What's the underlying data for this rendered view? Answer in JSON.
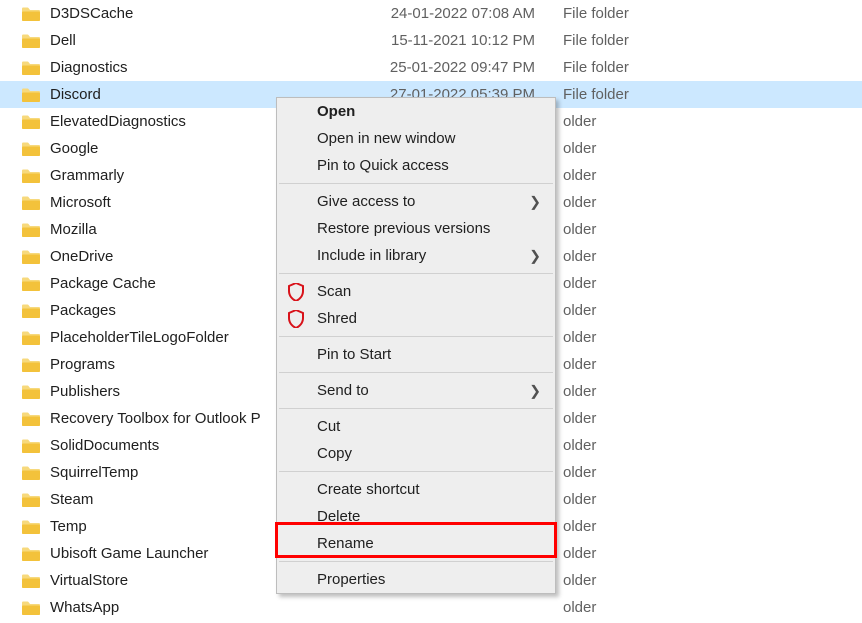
{
  "type_label": "File folder",
  "rows": [
    {
      "name": "D3DSCache",
      "date": "24-01-2022 07:08 AM"
    },
    {
      "name": "Dell",
      "date": "15-11-2021 10:12 PM"
    },
    {
      "name": "Diagnostics",
      "date": "25-01-2022 09:47 PM"
    },
    {
      "name": "Discord",
      "date": "27-01-2022 05:39 PM",
      "selected": true
    },
    {
      "name": "ElevatedDiagnostics"
    },
    {
      "name": "Google"
    },
    {
      "name": "Grammarly"
    },
    {
      "name": "Microsoft"
    },
    {
      "name": "Mozilla"
    },
    {
      "name": "OneDrive"
    },
    {
      "name": "Package Cache"
    },
    {
      "name": "Packages"
    },
    {
      "name": "PlaceholderTileLogoFolder"
    },
    {
      "name": "Programs"
    },
    {
      "name": "Publishers"
    },
    {
      "name": "Recovery Toolbox for Outlook P"
    },
    {
      "name": "SolidDocuments"
    },
    {
      "name": "SquirrelTemp"
    },
    {
      "name": "Steam"
    },
    {
      "name": "Temp"
    },
    {
      "name": "Ubisoft Game Launcher"
    },
    {
      "name": "VirtualStore"
    },
    {
      "name": "WhatsApp"
    }
  ],
  "ctx": {
    "open": "Open",
    "open_new": "Open in new window",
    "pin_quick": "Pin to Quick access",
    "give_access": "Give access to",
    "restore": "Restore previous versions",
    "include_lib": "Include in library",
    "scan": "Scan",
    "shred": "Shred",
    "pin_start": "Pin to Start",
    "send_to": "Send to",
    "cut": "Cut",
    "copy": "Copy",
    "create_shortcut": "Create shortcut",
    "delete": "Delete",
    "rename": "Rename",
    "properties": "Properties"
  },
  "partial_type": "older",
  "highlight_color": "#ff0000"
}
